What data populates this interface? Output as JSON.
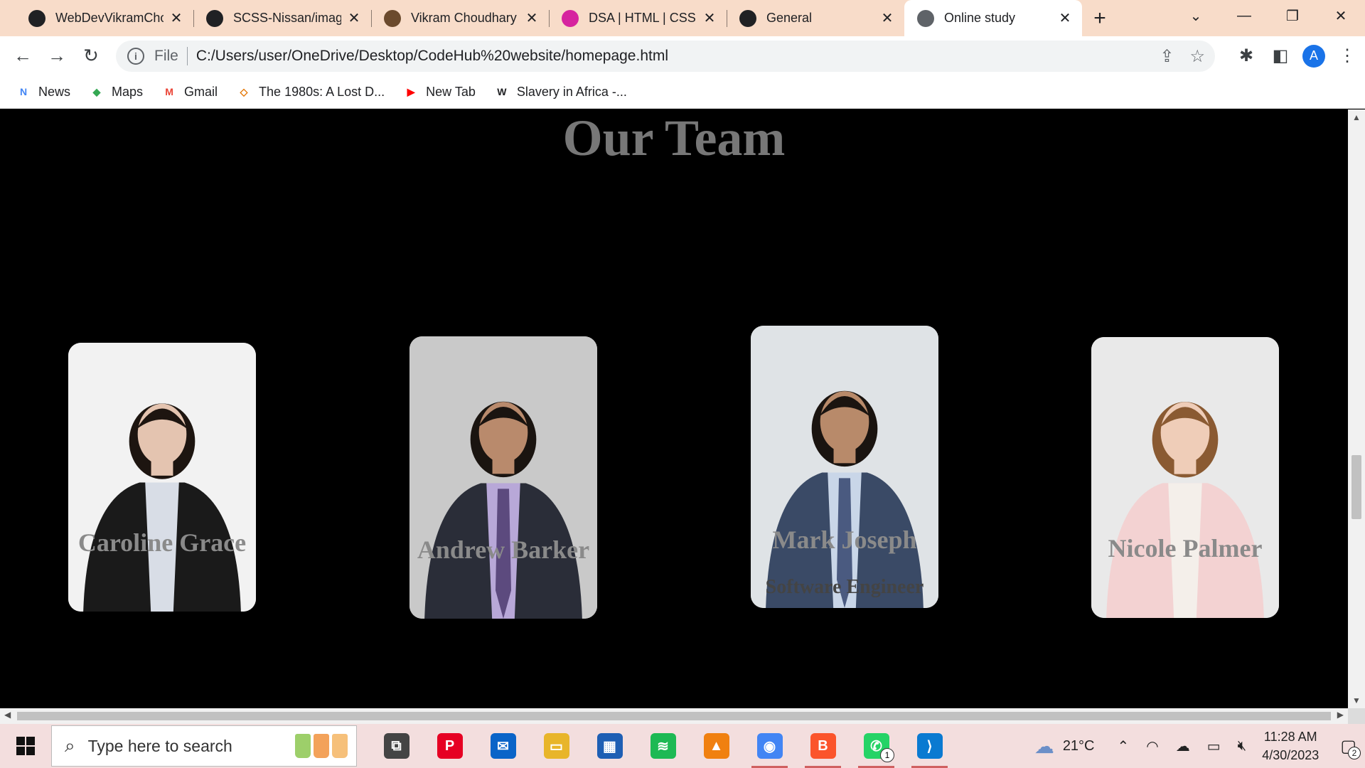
{
  "browser": {
    "tabs": [
      {
        "title": "WebDevVikramCho",
        "icon": "github-icon",
        "color": "#202124"
      },
      {
        "title": "SCSS-Nissan/image",
        "icon": "github-icon",
        "color": "#202124"
      },
      {
        "title": "Vikram Choudhary",
        "icon": "profile-icon",
        "color": "#6b4a2d"
      },
      {
        "title": "DSA | HTML | CSS |",
        "icon": "instagram-icon",
        "color": "#d6249f"
      },
      {
        "title": "General",
        "icon": "github-icon",
        "color": "#202124"
      },
      {
        "title": "Online study",
        "icon": "globe-icon",
        "color": "#5f6368",
        "active": true
      }
    ],
    "close_glyph": "✕",
    "new_tab_glyph": "+",
    "address": {
      "scheme": "File",
      "url": "C:/Users/user/OneDrive/Desktop/CodeHub%20website/homepage.html"
    },
    "profile_initial": "A",
    "bookmarks": [
      {
        "label": "News",
        "icon": "news-icon",
        "color": "#4285f4",
        "glyph": "N"
      },
      {
        "label": "Maps",
        "icon": "maps-icon",
        "color": "#34a853",
        "glyph": "◆"
      },
      {
        "label": "Gmail",
        "icon": "gmail-icon",
        "color": "#ea4335",
        "glyph": "M"
      },
      {
        "label": "The 1980s: A Lost D...",
        "icon": "page-icon",
        "color": "#e37400",
        "glyph": "◇"
      },
      {
        "label": "New Tab",
        "icon": "youtube-icon",
        "color": "#ff0000",
        "glyph": "▶"
      },
      {
        "label": "Slavery in Africa -...",
        "icon": "wikipedia-icon",
        "color": "#202124",
        "glyph": "W"
      }
    ]
  },
  "page": {
    "heading": "Our Team",
    "members": [
      {
        "name": "Caroline Grace",
        "bg": "#f2f2f2",
        "suit": "#1a1a1a",
        "shirt": "#d8dde6",
        "hair": "#1d1510",
        "skin": "#e4c4b0",
        "tie": ""
      },
      {
        "name": "Andrew Barker",
        "bg": "#c9c9c9",
        "suit": "#2a2d38",
        "shirt": "#b8a8d8",
        "hair": "#1a1410",
        "skin": "#b98a6c",
        "tie": "#5c4a7e"
      },
      {
        "name": "Mark Joseph",
        "bg": "#dfe3e6",
        "suit": "#3a4a66",
        "shirt": "#c9d6e8",
        "hair": "#1a1410",
        "skin": "#b88a6a",
        "tie": "#4a5a80",
        "role": "Software Engineer"
      },
      {
        "name": "Nicole Palmer",
        "bg": "#e9e9e9",
        "suit": "#f3d2d2",
        "shirt": "#f4efea",
        "hair": "#8a5a32",
        "skin": "#efcdb8",
        "tie": ""
      }
    ]
  },
  "taskbar": {
    "search_placeholder": "Type here to search",
    "apps": [
      {
        "name": "task-view-icon",
        "color": "#444444",
        "glyph": "⧉",
        "open": false
      },
      {
        "name": "pinterest-icon",
        "color": "#e60023",
        "glyph": "P",
        "open": false
      },
      {
        "name": "mail-icon",
        "color": "#0a64c8",
        "glyph": "✉",
        "open": false
      },
      {
        "name": "file-explorer-icon",
        "color": "#e8b52a",
        "glyph": "▭",
        "open": false
      },
      {
        "name": "store-icon",
        "color": "#1e5fb4",
        "glyph": "▦",
        "open": false
      },
      {
        "name": "spotify-icon",
        "color": "#1db954",
        "glyph": "≋",
        "open": false
      },
      {
        "name": "vlc-icon",
        "color": "#f08010",
        "glyph": "▲",
        "open": false
      },
      {
        "name": "chrome-icon",
        "color": "#4285f4",
        "glyph": "◉",
        "open": true
      },
      {
        "name": "brave-icon",
        "color": "#fb542b",
        "glyph": "B",
        "open": true
      },
      {
        "name": "whatsapp-icon",
        "color": "#25d366",
        "glyph": "✆",
        "open": true,
        "badge": "1"
      },
      {
        "name": "vscode-icon",
        "color": "#0a7ad1",
        "glyph": "⟩",
        "open": true
      }
    ],
    "weather": "21°C",
    "time": "11:28 AM",
    "date": "4/30/2023",
    "notifications": "2"
  }
}
